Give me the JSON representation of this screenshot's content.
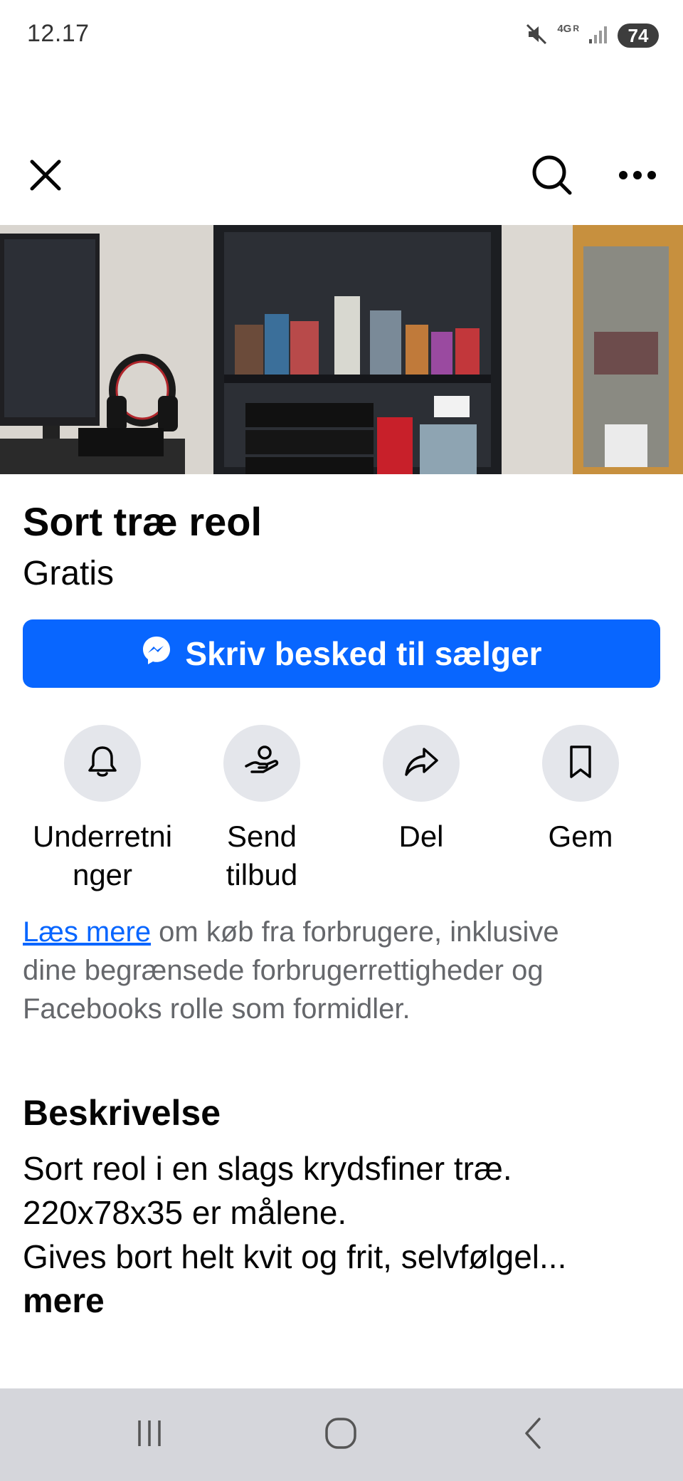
{
  "status_bar": {
    "time": "12.17",
    "network": "4G",
    "roaming": "R",
    "battery": "74",
    "icons": [
      "mute-icon",
      "data-arrows-icon",
      "signal-icon"
    ]
  },
  "nav": {
    "icons": [
      "close-icon",
      "search-icon",
      "more-icon"
    ]
  },
  "listing": {
    "title": "Sort træ reol",
    "price": "Gratis"
  },
  "cta": {
    "label": "Skriv besked til sælger",
    "icon": "messenger-icon"
  },
  "actions": [
    {
      "label_line1": "Underretni",
      "label_line2": "nger",
      "icon": "bell-icon"
    },
    {
      "label_line1": "Send",
      "label_line2": "tilbud",
      "icon": "offer-icon"
    },
    {
      "label_line1": "Del",
      "label_line2": "",
      "icon": "share-icon"
    },
    {
      "label_line1": "Gem",
      "label_line2": "",
      "icon": "bookmark-icon"
    }
  ],
  "info": {
    "link": "Læs mere",
    "text_line1": " om køb fra forbrugere, inklusive",
    "text_line2": "dine begrænsede forbrugerrettigheder og",
    "text_line3": "Facebooks rolle som formidler."
  },
  "description": {
    "heading": "Beskrivelse",
    "lines": [
      "Sort reol i en slags krydsfiner træ.",
      "220x78x35 er målene.",
      "Gives bort helt kvit og frit, selvfølgel..."
    ],
    "more": "mere"
  },
  "colors": {
    "accent": "#0866ff",
    "secondary_text": "#65676b",
    "circle_bg": "#e4e6eb",
    "nav_bar_bg": "#d5d6db"
  }
}
